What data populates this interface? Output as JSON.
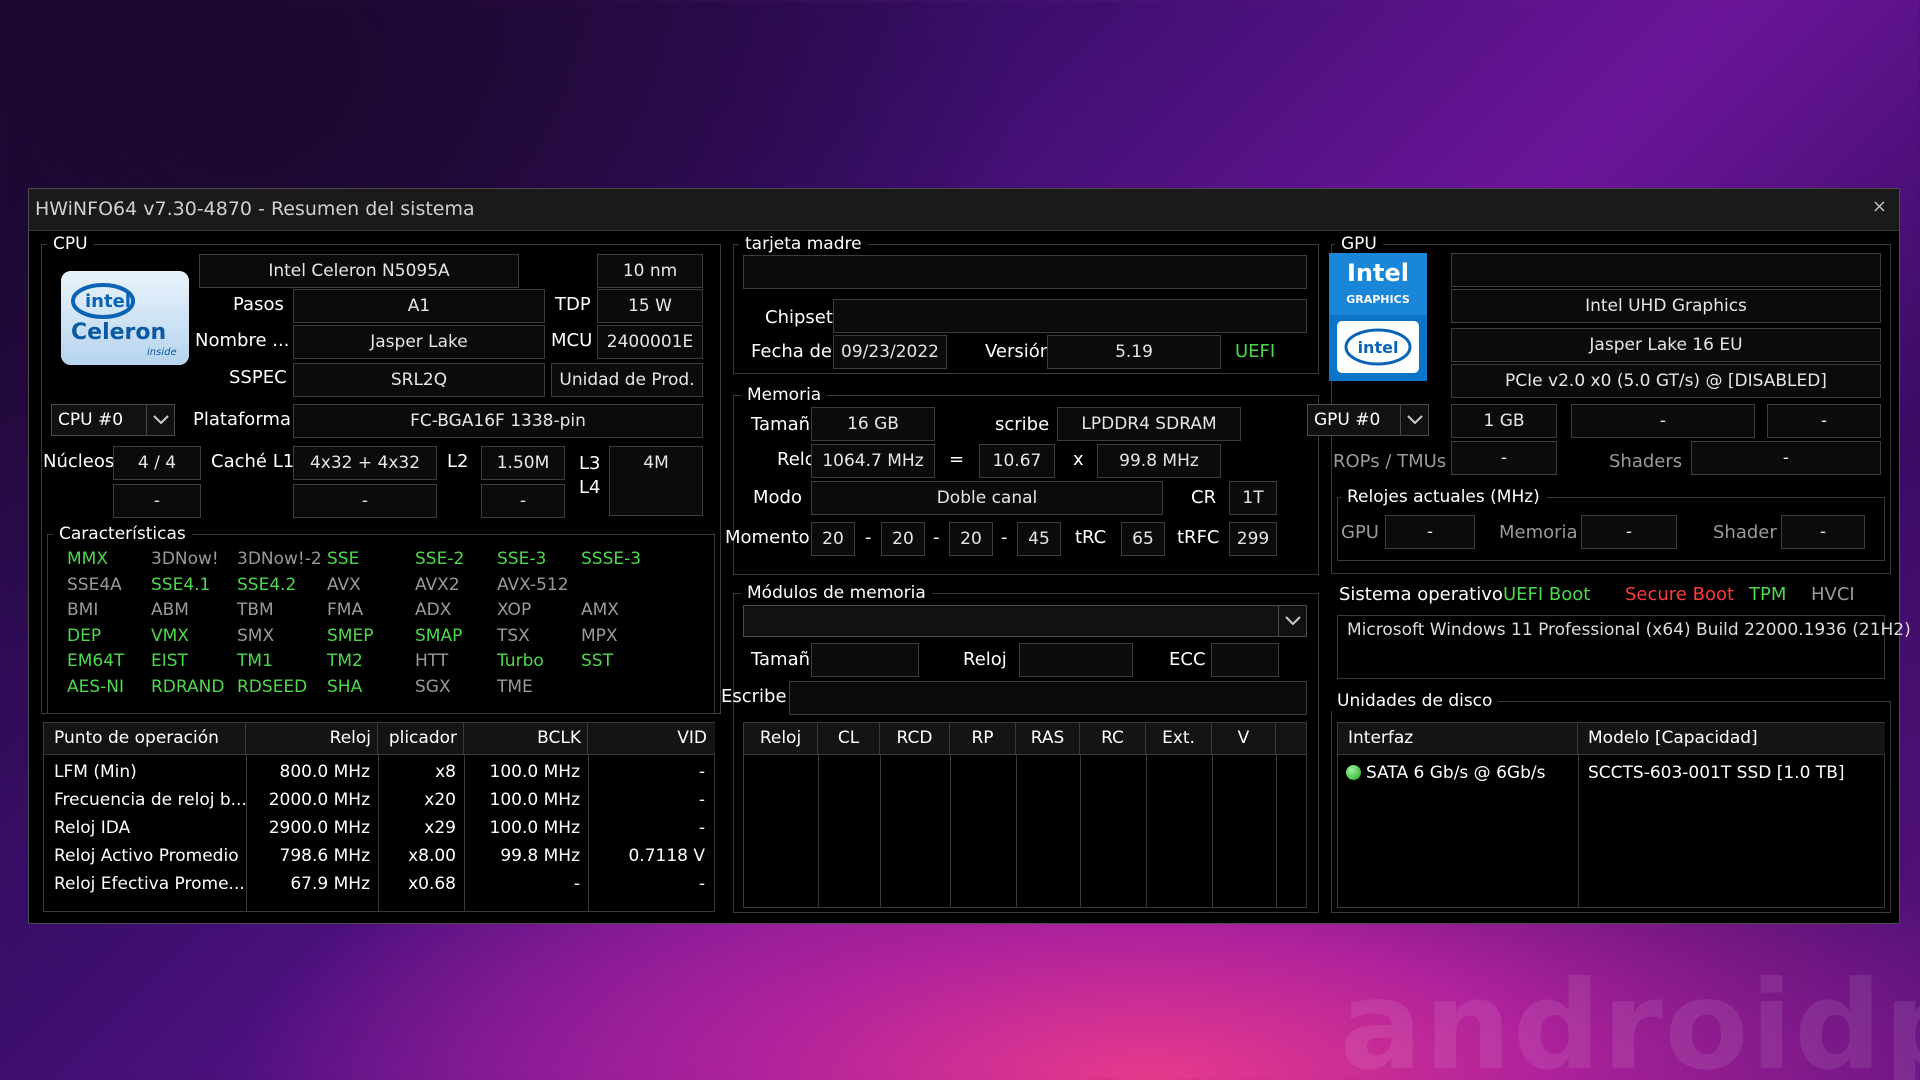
{
  "window": {
    "title": "HWiNFO64 v7.30-4870 - Resumen del sistema",
    "close": "×"
  },
  "watermark": "androidpc",
  "cpu": {
    "group": "CPU",
    "name": "Intel Celeron N5095A",
    "process": "10 nm",
    "logo": {
      "brand": "intel",
      "line": "Celeron",
      "tag": "inside"
    },
    "pasos_label": "Pasos",
    "pasos": "A1",
    "tdp_label": "TDP",
    "tdp": "15 W",
    "nombre_label": "Nombre ...",
    "nombre": "Jasper Lake",
    "mcu_label": "MCU",
    "mcu": "2400001E",
    "sspec_label": "SSPEC",
    "sspec": "SRL2Q",
    "unit": "Unidad de Prod.",
    "selector": "CPU #0",
    "plataforma_label": "Plataforma",
    "plataforma": "FC-BGA16F 1338-pin",
    "nucleos_label": "Núcleos",
    "nucleos": "4 / 4",
    "cache_l1_label": "Caché L1",
    "cache_l1": "4x32 + 4x32",
    "l2_label": "L2",
    "l2": "1.50M",
    "l3_label": "L3",
    "l3": "4M",
    "l4_label": "L4",
    "dash": "-",
    "features_label": "Características",
    "features": [
      [
        {
          "t": "MMX",
          "c": "g"
        },
        {
          "t": "3DNow!",
          "c": "d"
        },
        {
          "t": "3DNow!-2",
          "c": "d"
        },
        {
          "t": "SSE",
          "c": "g"
        },
        {
          "t": "SSE-2",
          "c": "g"
        },
        {
          "t": "SSE-3",
          "c": "g"
        },
        {
          "t": "SSSE-3",
          "c": "g"
        }
      ],
      [
        {
          "t": "SSE4A",
          "c": "d"
        },
        {
          "t": "SSE4.1",
          "c": "g"
        },
        {
          "t": "SSE4.2",
          "c": "g"
        },
        {
          "t": "AVX",
          "c": "d"
        },
        {
          "t": "AVX2",
          "c": "d"
        },
        {
          "t": "AVX-512",
          "c": "d"
        },
        {
          "t": "",
          "c": "d"
        }
      ],
      [
        {
          "t": "BMI",
          "c": "d"
        },
        {
          "t": "ABM",
          "c": "d"
        },
        {
          "t": "TBM",
          "c": "d"
        },
        {
          "t": "FMA",
          "c": "d"
        },
        {
          "t": "ADX",
          "c": "d"
        },
        {
          "t": "XOP",
          "c": "d"
        },
        {
          "t": "AMX",
          "c": "d"
        }
      ],
      [
        {
          "t": "DEP",
          "c": "g"
        },
        {
          "t": "VMX",
          "c": "g"
        },
        {
          "t": "SMX",
          "c": "d"
        },
        {
          "t": "SMEP",
          "c": "g"
        },
        {
          "t": "SMAP",
          "c": "g"
        },
        {
          "t": "TSX",
          "c": "d"
        },
        {
          "t": "MPX",
          "c": "d"
        }
      ],
      [
        {
          "t": "EM64T",
          "c": "g"
        },
        {
          "t": "EIST",
          "c": "g"
        },
        {
          "t": "TM1",
          "c": "g"
        },
        {
          "t": "TM2",
          "c": "g"
        },
        {
          "t": "HTT",
          "c": "d"
        },
        {
          "t": "Turbo",
          "c": "g"
        },
        {
          "t": "SST",
          "c": "g"
        }
      ],
      [
        {
          "t": "AES-NI",
          "c": "g"
        },
        {
          "t": "RDRAND",
          "c": "g"
        },
        {
          "t": "RDSEED",
          "c": "g"
        },
        {
          "t": "SHA",
          "c": "g"
        },
        {
          "t": "SGX",
          "c": "d"
        },
        {
          "t": "TME",
          "c": "d"
        },
        {
          "t": "",
          "c": "d"
        }
      ]
    ],
    "op_headers": [
      "Punto de operación",
      "Reloj",
      "plicador",
      "BCLK",
      "VID"
    ],
    "op_rows": [
      [
        "LFM (Min)",
        "800.0 MHz",
        "x8",
        "100.0 MHz",
        "-"
      ],
      [
        "Frecuencia de reloj b...",
        "2000.0 MHz",
        "x20",
        "100.0 MHz",
        "-"
      ],
      [
        "Reloj IDA",
        "2900.0 MHz",
        "x29",
        "100.0 MHz",
        "-"
      ],
      [
        "Reloj Activo Promedio",
        "798.6 MHz",
        "x8.00",
        "99.8 MHz",
        "0.7118 V"
      ],
      [
        "Reloj Efectiva Prome...",
        "67.9 MHz",
        "x0.68",
        "-",
        "-"
      ]
    ]
  },
  "mb": {
    "group": "tarjeta madre",
    "chipset_label": "Chipset",
    "fecha_label": "Fecha de",
    "fecha": "09/23/2022",
    "version_label": "Versión",
    "version": "5.19",
    "uefi": "UEFI"
  },
  "memory": {
    "group": "Memoria",
    "size_label": "Tamaño",
    "size": "16 GB",
    "type_label": "scribe",
    "type": "LPDDR4 SDRAM",
    "clock_label": "Reloj",
    "clock": "1064.7 MHz",
    "eq": "=",
    "mult": "10.67",
    "x": "x",
    "bclk": "99.8 MHz",
    "mode_label": "Modo",
    "mode": "Doble canal",
    "cr_label": "CR",
    "cr": "1T",
    "timing_label": "Momento",
    "t1": "20",
    "t2": "20",
    "t3": "20",
    "t4": "45",
    "trc_label": "tRC",
    "trc": "65",
    "trfc_label": "tRFC",
    "trfc": "299",
    "sep": "-"
  },
  "modules": {
    "group": "Módulos de memoria",
    "size_label": "Tamaño",
    "clock_label": "Reloj",
    "ecc_label": "ECC",
    "type_label": "Escribe",
    "headers": [
      "Reloj",
      "CL",
      "RCD",
      "RP",
      "RAS",
      "RC",
      "Ext.",
      "V"
    ]
  },
  "gpu": {
    "group": "GPU",
    "logo_top": "Intel",
    "logo_sub": "GRAPHICS",
    "logo_brand": "intel",
    "name": "Intel UHD Graphics",
    "codename": "Jasper Lake 16 EU",
    "pcie": "PCIe v2.0 x0 (5.0 GT/s) @ [DISABLED]",
    "selector": "GPU #0",
    "vram": "1 GB",
    "dash": "-",
    "rops_label": "ROPs / TMUs",
    "shaders_label": "Shaders",
    "clocks_group": "Relojes actuales (MHz)",
    "gpu_label": "GPU",
    "mem_label": "Memoria",
    "shader_label": "Shader"
  },
  "os": {
    "label": "Sistema operativo",
    "uefi_boot": "UEFI Boot",
    "secure_boot": "Secure Boot",
    "tpm": "TPM",
    "hvci": "HVCI",
    "name": "Microsoft Windows 11 Professional (x64) Build 22000.1936 (21H2)"
  },
  "disks": {
    "group": "Unidades de disco",
    "headers": [
      "Interfaz",
      "Modelo [Capacidad]"
    ],
    "rows": [
      {
        "iface": "SATA 6 Gb/s @ 6Gb/s",
        "model": "SCCTS-603-001T SSD [1.0 TB]"
      }
    ]
  }
}
